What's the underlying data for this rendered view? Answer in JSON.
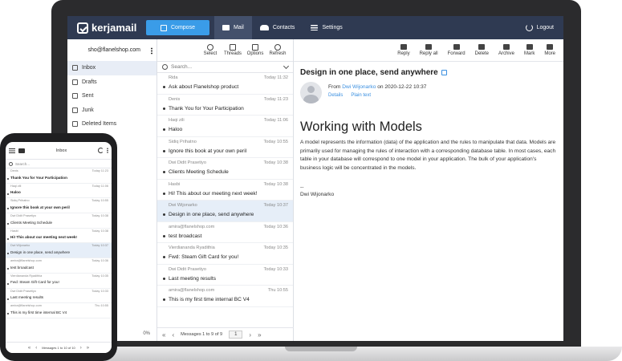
{
  "app": {
    "logo_text": "kerjamail"
  },
  "topnav": {
    "compose": "Compose",
    "mail": "Mail",
    "contacts": "Contacts",
    "settings": "Settings",
    "logout": "Logout"
  },
  "account": {
    "email": "sho@flanelshop.com",
    "quota": "0%"
  },
  "folders": [
    {
      "label": "Inbox",
      "icon": "inbox-icon"
    },
    {
      "label": "Drafts",
      "icon": "pencil-icon"
    },
    {
      "label": "Sent",
      "icon": "send-icon"
    },
    {
      "label": "Junk",
      "icon": "trash-icon"
    },
    {
      "label": "Deleted Items",
      "icon": "trash-icon"
    }
  ],
  "list_toolbar": {
    "select": "Select",
    "threads": "Threads",
    "options": "Options",
    "refresh": "Refresh"
  },
  "search": {
    "placeholder": "Search..."
  },
  "messages": [
    {
      "from": "Rida",
      "time": "Today 11:32",
      "subject": "Ask about Flanelshop product"
    },
    {
      "from": "Denis",
      "time": "Today 11:23",
      "subject": "Thank You for Your Participation"
    },
    {
      "from": "Haqi zili",
      "time": "Today 11:06",
      "subject": "Haloo"
    },
    {
      "from": "Sidiq Prihatno",
      "time": "Today 10:55",
      "subject": "Ignore this book at your own peril"
    },
    {
      "from": "Dwi Didit Prasetiyo",
      "time": "Today 10:38",
      "subject": "Clients Meeting Schedule"
    },
    {
      "from": "Hasbi",
      "time": "Today 10:38",
      "subject": "Hi! This about our meeting next week!"
    },
    {
      "from": "Dwi Wijonarko",
      "time": "Today 10:37",
      "subject": "Design in one place, send anywhere"
    },
    {
      "from": "amira@flanelshop.com",
      "time": "Today 10:36",
      "subject": "test broadcast"
    },
    {
      "from": "Vierdiananda Ryadithia",
      "time": "Today 10:35",
      "subject": "Fwd: Steam Gift Card for you!"
    },
    {
      "from": "Dwi Didit Prasetiyo",
      "time": "Today 10:33",
      "subject": "Last meeting results"
    },
    {
      "from": "amira@flanelshop.com",
      "time": "Thu 10:55",
      "subject": "This is my first time internal BC V4"
    }
  ],
  "list_footer": {
    "pages": "Messages 1 to 9 of 9",
    "page_num": "1"
  },
  "read_toolbar": {
    "reply": "Reply",
    "reply_all": "Reply all",
    "forward": "Forward",
    "delete": "Delete",
    "archive": "Archive",
    "mark": "Mark",
    "more": "More"
  },
  "reading": {
    "subject": "Design in one place, send anywhere",
    "from_prefix": "From",
    "from_name": "Dwi Wijonarko",
    "date": "on 2020-12-22 10:37",
    "details": "Details",
    "plain": "Plain text",
    "heading": "Working with Models",
    "body": "A model represents the information (data) of the application and the rules to manipulate that data. Models are primarily used for managing the rules of interaction with a corresponding database table. In most cases, each table in your database will correspond to one model in your application. The bulk of your application's business logic will be concentrated in the models.",
    "sig_sep": "--",
    "signature": "Dwi Wijonarko"
  },
  "phone": {
    "title": "Inbox",
    "search_placeholder": "Search...",
    "footer": "Messages 1 to 10 of 10",
    "messages": [
      {
        "from": "Denis",
        "time": "Today 11:23",
        "subject": "Thank You for Your Participation",
        "bold": true
      },
      {
        "from": "Haqi zili",
        "time": "Today 11:06",
        "subject": "Haloo",
        "bold": true
      },
      {
        "from": "Sidiq Prihatno",
        "time": "Today 10:55",
        "subject": "Ignore this book at your own peril",
        "bold": true
      },
      {
        "from": "Dwi Didit Prasetiyo",
        "time": "Today 10:38",
        "subject": "Clients Meeting Schedule",
        "bold": false
      },
      {
        "from": "Hasbi",
        "time": "Today 10:38",
        "subject": "Hi! This about our meeting next week!",
        "bold": true
      },
      {
        "from": "Dwi Wijonarko",
        "time": "Today 10:37",
        "subject": "Design in one place, send anywhere",
        "bold": false
      },
      {
        "from": "amira@flanelshop.com",
        "time": "Today 10:36",
        "subject": "test broadcast",
        "bold": false
      },
      {
        "from": "Vierdiananda Ryadithia",
        "time": "Today 10:35",
        "subject": "Fwd: Steam Gift Card for you!",
        "bold": false
      },
      {
        "from": "Dwi Didit Prasetiyo",
        "time": "Today 10:33",
        "subject": "Last meeting results",
        "bold": false
      },
      {
        "from": "amira@flanelshop.com",
        "time": "Thu 10:55",
        "subject": "This is my first time internal BC V4",
        "bold": false
      }
    ]
  },
  "colors": {
    "nav_bg": "#2f3a52",
    "accent": "#3a9ce8",
    "selected_row": "#e6eef8"
  }
}
